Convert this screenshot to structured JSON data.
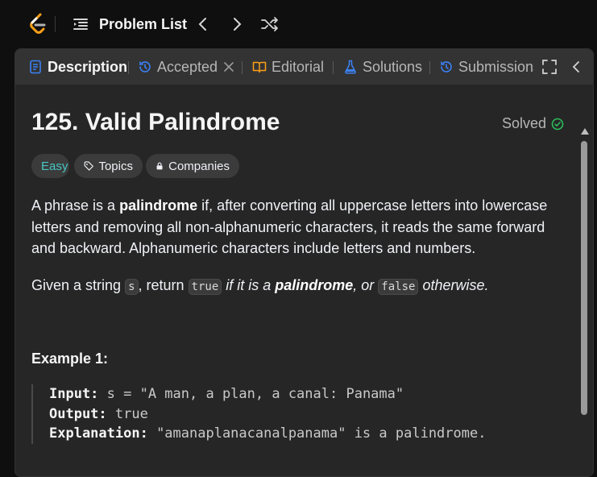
{
  "topbar": {
    "logo_icon": "leetcode-logo",
    "problem_list_icon": "list-icon",
    "problem_list_label": "Problem List",
    "prev_icon": "chevron-left-icon",
    "next_icon": "chevron-right-icon",
    "shuffle_icon": "shuffle-icon"
  },
  "tabs": [
    {
      "label": "Description",
      "icon": "document-icon",
      "active": true
    },
    {
      "label": "Accepted",
      "icon": "history-icon",
      "closable": true
    },
    {
      "label": "Editorial",
      "icon": "book-icon"
    },
    {
      "label": "Solutions",
      "icon": "flask-icon"
    },
    {
      "label": "Submissions",
      "icon": "history-icon"
    }
  ],
  "problem": {
    "title": "125. Valid Palindrome",
    "status": "Solved",
    "difficulty": "Easy",
    "topics_label": "Topics",
    "companies_label": "Companies",
    "para1_a": "A phrase is a ",
    "para1_b": "palindrome",
    "para1_c": " if, after converting all uppercase letters into lowercase letters and removing all non-alphanumeric characters, it reads the same forward and backward. Alphanumeric characters include letters and numbers.",
    "para2_a": "Given a string ",
    "para2_s": "s",
    "para2_b": ", return ",
    "para2_true": "true",
    "para2_c": " if it is a ",
    "para2_d": "palindrome",
    "para2_e": ", or ",
    "para2_false": "false",
    "para2_f": " otherwise."
  },
  "example1": {
    "heading": "Example 1:",
    "input_label": "Input:",
    "input_value": " s = \"A man, a plan, a canal: Panama\"",
    "output_label": "Output:",
    "output_value": " true",
    "explanation_label": "Explanation:",
    "explanation_value": " \"amanaplanacanalpanama\" is a palindrome."
  },
  "colors": {
    "easy": "#46c6c2",
    "solved_check": "#2cbb5d",
    "description_icon": "#3b82f6",
    "history_icon": "#3b82f6",
    "editorial_icon": "#ffa116",
    "solutions_icon": "#3b82f6"
  }
}
